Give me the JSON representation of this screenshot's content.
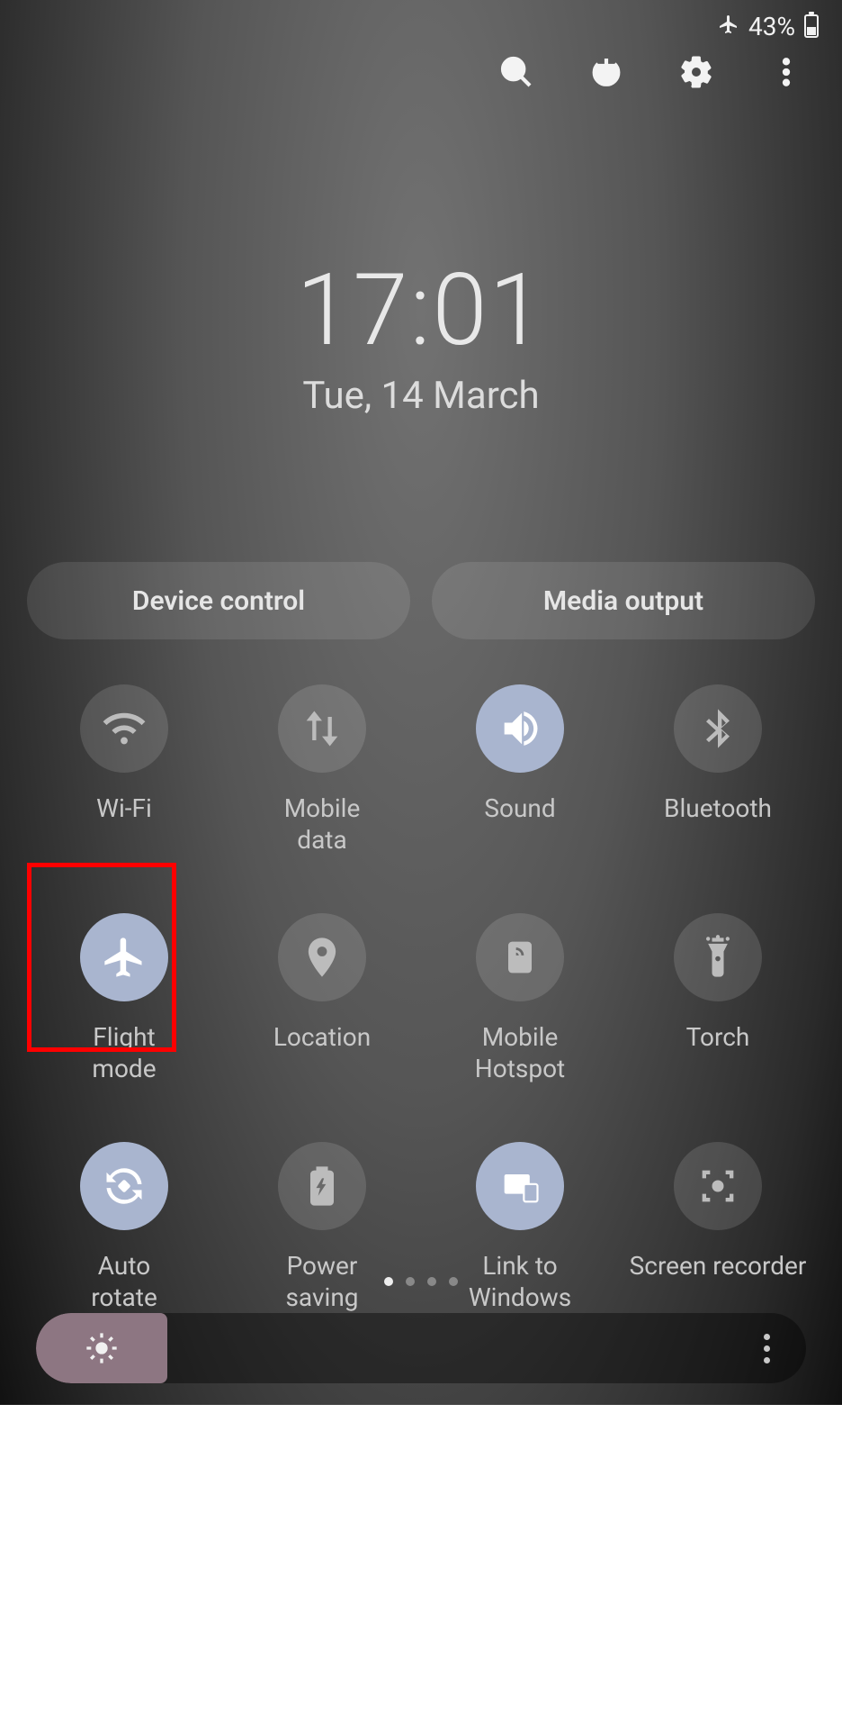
{
  "status": {
    "battery_percent": "43%"
  },
  "clock": {
    "time": "17:01",
    "date": "Tue, 14 March"
  },
  "pills": {
    "device_control": "Device control",
    "media_output": "Media output"
  },
  "tiles": [
    {
      "id": "wifi",
      "label": "Wi-Fi",
      "active": false,
      "icon": "wifi-icon"
    },
    {
      "id": "mobile-data",
      "label": "Mobile data",
      "active": false,
      "icon": "data-arrows-icon"
    },
    {
      "id": "sound",
      "label": "Sound",
      "active": true,
      "icon": "speaker-icon"
    },
    {
      "id": "bluetooth",
      "label": "Bluetooth",
      "active": false,
      "icon": "bluetooth-icon"
    },
    {
      "id": "flight-mode",
      "label": "Flight mode",
      "active": true,
      "icon": "airplane-icon",
      "highlighted": true
    },
    {
      "id": "location",
      "label": "Location",
      "active": false,
      "icon": "location-pin-icon"
    },
    {
      "id": "mobile-hotspot",
      "label": "Mobile Hotspot",
      "active": false,
      "icon": "hotspot-icon"
    },
    {
      "id": "torch",
      "label": "Torch",
      "active": false,
      "icon": "flashlight-icon"
    },
    {
      "id": "auto-rotate",
      "label": "Auto rotate",
      "active": true,
      "icon": "rotate-icon"
    },
    {
      "id": "power-saving",
      "label": "Power saving",
      "active": false,
      "icon": "battery-saving-icon"
    },
    {
      "id": "link-to-windows",
      "label": "Link to Windows",
      "active": true,
      "icon": "windows-link-icon"
    },
    {
      "id": "screen-recorder",
      "label": "Screen recorder",
      "active": false,
      "icon": "record-screen-icon"
    }
  ],
  "pagination": {
    "total": 4,
    "current": 0
  },
  "brightness": {
    "percent": 17
  },
  "colors": {
    "active_tile": "#a9b5cf",
    "highlight": "#ff0000",
    "brightness_fill": "#8d7682"
  }
}
